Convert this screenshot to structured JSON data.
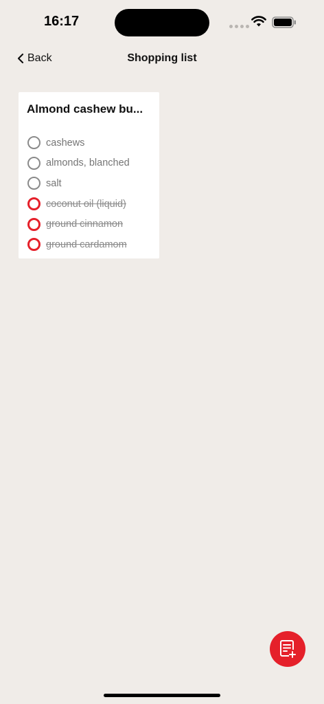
{
  "status_bar": {
    "time": "16:17"
  },
  "nav": {
    "back_label": "Back",
    "title": "Shopping list"
  },
  "card": {
    "title": "Almond cashew bu...",
    "items": [
      {
        "label": "cashews",
        "checked": false
      },
      {
        "label": "almonds, blanched",
        "checked": false
      },
      {
        "label": "salt",
        "checked": false
      },
      {
        "label": "coconut oil (liquid)",
        "checked": true
      },
      {
        "label": "ground cinnamon",
        "checked": true
      },
      {
        "label": "ground cardamom",
        "checked": true
      }
    ]
  },
  "colors": {
    "accent": "#e5202a",
    "background": "#f0ece8",
    "card": "#ffffff"
  },
  "icons": {
    "back": "chevron-left-icon",
    "fab": "list-add-icon"
  }
}
